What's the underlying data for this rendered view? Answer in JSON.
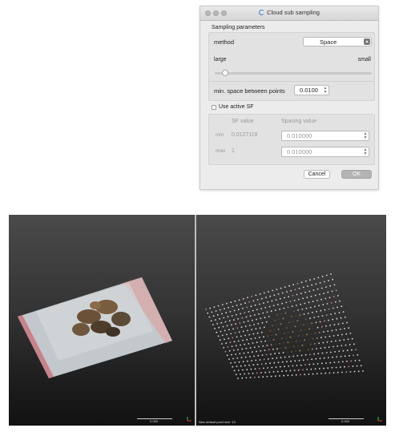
{
  "dialog": {
    "title": "Cloud sub sampling",
    "section_title": "Sampling parameters",
    "method_label": "method",
    "method_value": "Space",
    "slider_left_label": "large",
    "slider_right_label": "small",
    "min_space_label": "min. space between points",
    "min_space_value": "0.0100",
    "use_sf_label": "Use active SF",
    "sf_header_value": "SF value",
    "sf_header_spacing": "Spacing value",
    "rows": [
      {
        "label": "min",
        "sf_value": "0.0127118",
        "spacing": "0.010000"
      },
      {
        "label": "max",
        "sf_value": "1",
        "spacing": "0.010000"
      }
    ],
    "cancel_label": "Cancel",
    "ok_label": "OK"
  },
  "viewports": {
    "left": {
      "scale_label": "0.065"
    },
    "right": {
      "scale_label": "0.065",
      "status": "New default point size: 10"
    }
  }
}
